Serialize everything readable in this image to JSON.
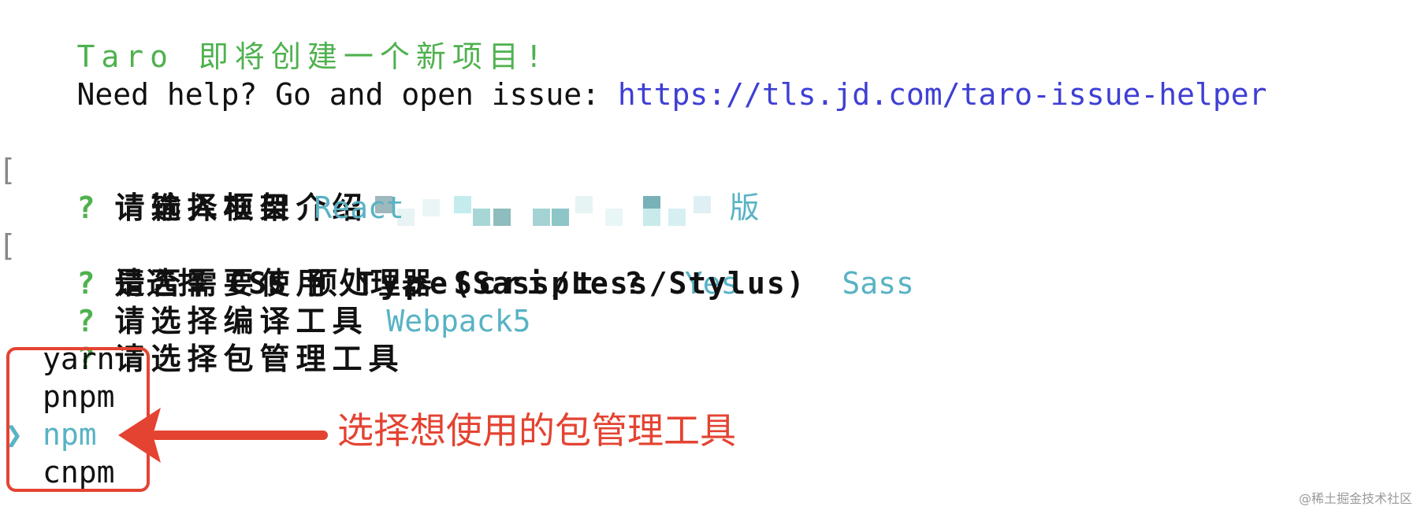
{
  "header": {
    "title": "Taro 即将创建一个新项目!",
    "help_prefix": "Need help? Go and open issue: ",
    "help_link": "https://tls.jd.com/taro-issue-helper"
  },
  "prompts": [
    {
      "mark": "?",
      "question": "请输入项目介绍",
      "answer": "版"
    },
    {
      "mark": "?",
      "question": "请选择框架",
      "answer": "React"
    },
    {
      "mark": "?",
      "question": "是否需要使用 TypeScript ?",
      "answer": "Yes"
    },
    {
      "mark": "?",
      "question": "请选择 CSS 预处理器 (Sass/Less/Stylus)",
      "answer": "Sass"
    },
    {
      "mark": "?",
      "question": "请选择编译工具",
      "answer": "Webpack5"
    },
    {
      "mark": "?",
      "question": "请选择包管理工具",
      "answer": ""
    }
  ],
  "package_manager": {
    "pointer": "❯",
    "options": [
      "yarn",
      "pnpm",
      "npm",
      "cnpm"
    ],
    "selected": "npm"
  },
  "annotation": {
    "text": "选择想使用的包管理工具",
    "color": "#e44332"
  },
  "watermark": "@稀土掘金技术社区",
  "colors": {
    "prompt_mark": "#4fb14f",
    "answer": "#58b3c4",
    "link": "#3f3fd4"
  }
}
